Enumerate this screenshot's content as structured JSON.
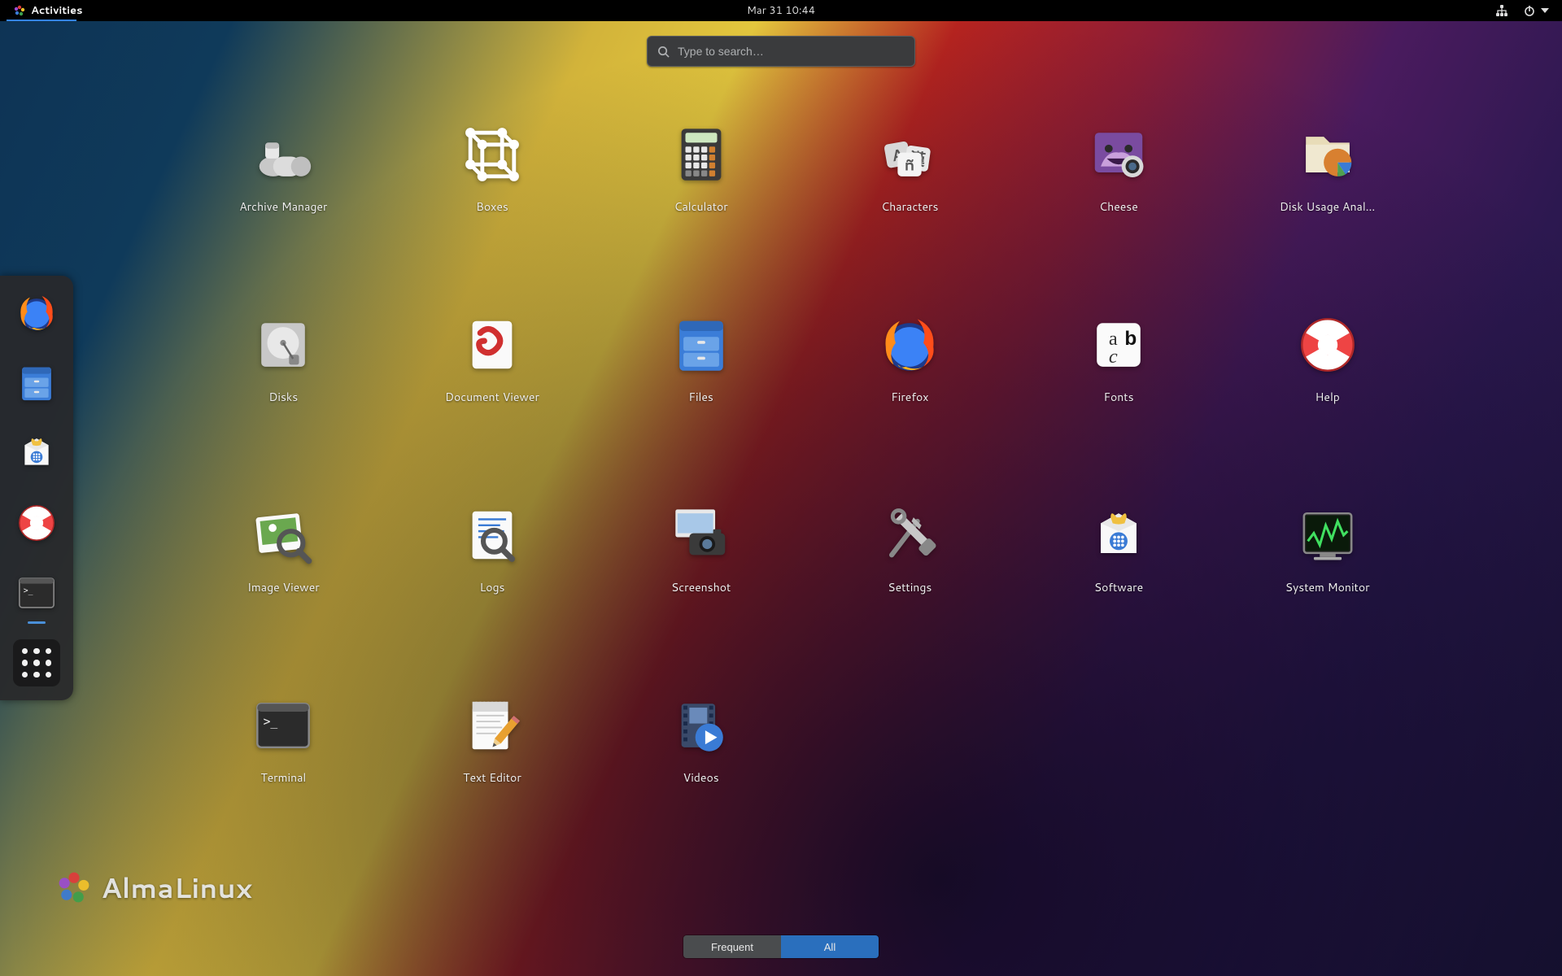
{
  "topbar": {
    "activities_label": "Activities",
    "clock": "Mar 31  10:44"
  },
  "search": {
    "placeholder": "Type to search…"
  },
  "dash": {
    "items": [
      {
        "name": "firefox",
        "running": false
      },
      {
        "name": "files",
        "running": false
      },
      {
        "name": "software",
        "running": false
      },
      {
        "name": "help",
        "running": false
      },
      {
        "name": "terminal",
        "running": true
      }
    ]
  },
  "apps": [
    {
      "name": "archive-manager",
      "label": "Archive Manager"
    },
    {
      "name": "boxes",
      "label": "Boxes"
    },
    {
      "name": "calculator",
      "label": "Calculator"
    },
    {
      "name": "characters",
      "label": "Characters"
    },
    {
      "name": "cheese",
      "label": "Cheese"
    },
    {
      "name": "disk-usage",
      "label": "Disk Usage Anal…"
    },
    {
      "name": "disks",
      "label": "Disks"
    },
    {
      "name": "document-viewer",
      "label": "Document Viewer"
    },
    {
      "name": "files",
      "label": "Files"
    },
    {
      "name": "firefox",
      "label": "Firefox"
    },
    {
      "name": "fonts",
      "label": "Fonts"
    },
    {
      "name": "help",
      "label": "Help"
    },
    {
      "name": "image-viewer",
      "label": "Image Viewer"
    },
    {
      "name": "logs",
      "label": "Logs"
    },
    {
      "name": "screenshot",
      "label": "Screenshot"
    },
    {
      "name": "settings",
      "label": "Settings"
    },
    {
      "name": "software",
      "label": "Software"
    },
    {
      "name": "system-monitor",
      "label": "System Monitor"
    },
    {
      "name": "terminal",
      "label": "Terminal"
    },
    {
      "name": "text-editor",
      "label": "Text Editor"
    },
    {
      "name": "videos",
      "label": "Videos"
    }
  ],
  "toggle": {
    "frequent": "Frequent",
    "all": "All"
  },
  "branding": {
    "text": "AlmaLinux"
  }
}
